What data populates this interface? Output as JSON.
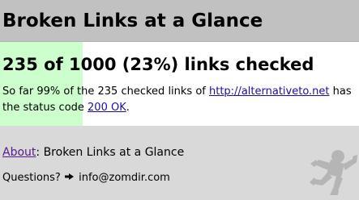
{
  "header": {
    "title": "Broken Links at a Glance"
  },
  "result": {
    "checked": 235,
    "total": 1000,
    "progress_fraction": 0.23,
    "headline": "235 of 1000 (23%) links checked",
    "text_prefix": "So far 99% of the 235 checked links of ",
    "site_link": "http://alternativeto.net",
    "text_middle": " has the status code ",
    "status_link": "200 OK",
    "text_suffix": "."
  },
  "footer": {
    "about_link": "About",
    "about_text": ": Broken Links at a Glance",
    "questions_label": "Questions?",
    "email": "info@zomdir.com",
    "arrow_icon": "right-arrow-icon",
    "mascot_icon": "mascot-silhouette-icon"
  },
  "colors": {
    "header_bg": "#c1c1c1",
    "progress_fill": "#ccffcc",
    "footer_bg": "#d9d9d9",
    "link": "#1a0dab",
    "visited_link": "#551a8b",
    "mascot": "#b5b5b5"
  }
}
